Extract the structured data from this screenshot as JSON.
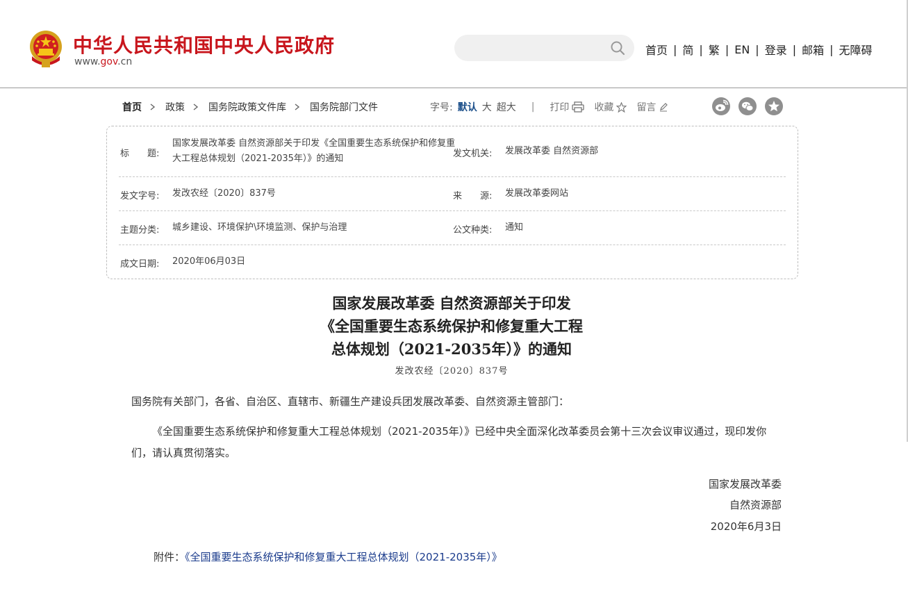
{
  "header": {
    "site_title": "中华人民共和国中央人民政府",
    "site_url_prefix": "www.",
    "site_url_gov": "gov",
    "site_url_suffix": ".cn",
    "search_placeholder": "",
    "search_icon": "search-icon",
    "nav": [
      "首页",
      "简",
      "繁",
      "EN",
      "登录",
      "邮箱",
      "无障碍"
    ],
    "nav_separator": "|",
    "brand_color": "#c8161d"
  },
  "breadcrumb": {
    "items": [
      "首页",
      "政策",
      "国务院政策文件库",
      "国务院部门文件"
    ]
  },
  "toolbar": {
    "font_size_label": "字号:",
    "font_sizes": [
      "默认",
      "大",
      "超大"
    ],
    "active_font_size": "默认",
    "separator": "|",
    "print_label": "打印",
    "favorite_label": "收藏",
    "comment_label": "留言",
    "share_icons": [
      "weibo-icon",
      "wechat-icon",
      "qzone-star-icon"
    ]
  },
  "info": {
    "title_label": "标　　题:",
    "title_value": "国家发展改革委 自然资源部关于印发《全国重要生态系统保护和修复重大工程总体规划（2021-2035年）》的通知",
    "issuer_label": "发文机关:",
    "issuer_value": "发展改革委 自然资源部",
    "doc_no_label": "发文字号:",
    "doc_no_value": "发改农经〔2020〕837号",
    "source_label": "来　　源:",
    "source_value": "发展改革委网站",
    "topic_label": "主题分类:",
    "topic_value": "城乡建设、环境保护\\环境监测、保护与治理",
    "type_label": "公文种类:",
    "type_value": "通知",
    "date_label": "成文日期:",
    "date_value": "2020年06月03日"
  },
  "article": {
    "title_lines": [
      "国家发展改革委 自然资源部关于印发",
      "《全国重要生态系统保护和修复重大工程",
      "总体规划（2021-2035年）》的通知"
    ],
    "doc_number": "发改农经〔2020〕837号",
    "salutation": "国务院有关部门，各省、自治区、直辖市、新疆生产建设兵团发展改革委、自然资源主管部门：",
    "body": "《全国重要生态系统保护和修复重大工程总体规划（2021-2035年）》已经中央全面深化改革委员会第十三次会议审议通过，现印发你们，请认真贯彻落实。",
    "signature_1": "国家发展改革委",
    "signature_2": "自然资源部",
    "signature_date": "2020年6月3日",
    "attachment_label": "附件：",
    "attachment_link": "《全国重要生态系统保护和修复重大工程总体规划（2021-2035年）》",
    "link_color": "#1a3b8c"
  }
}
